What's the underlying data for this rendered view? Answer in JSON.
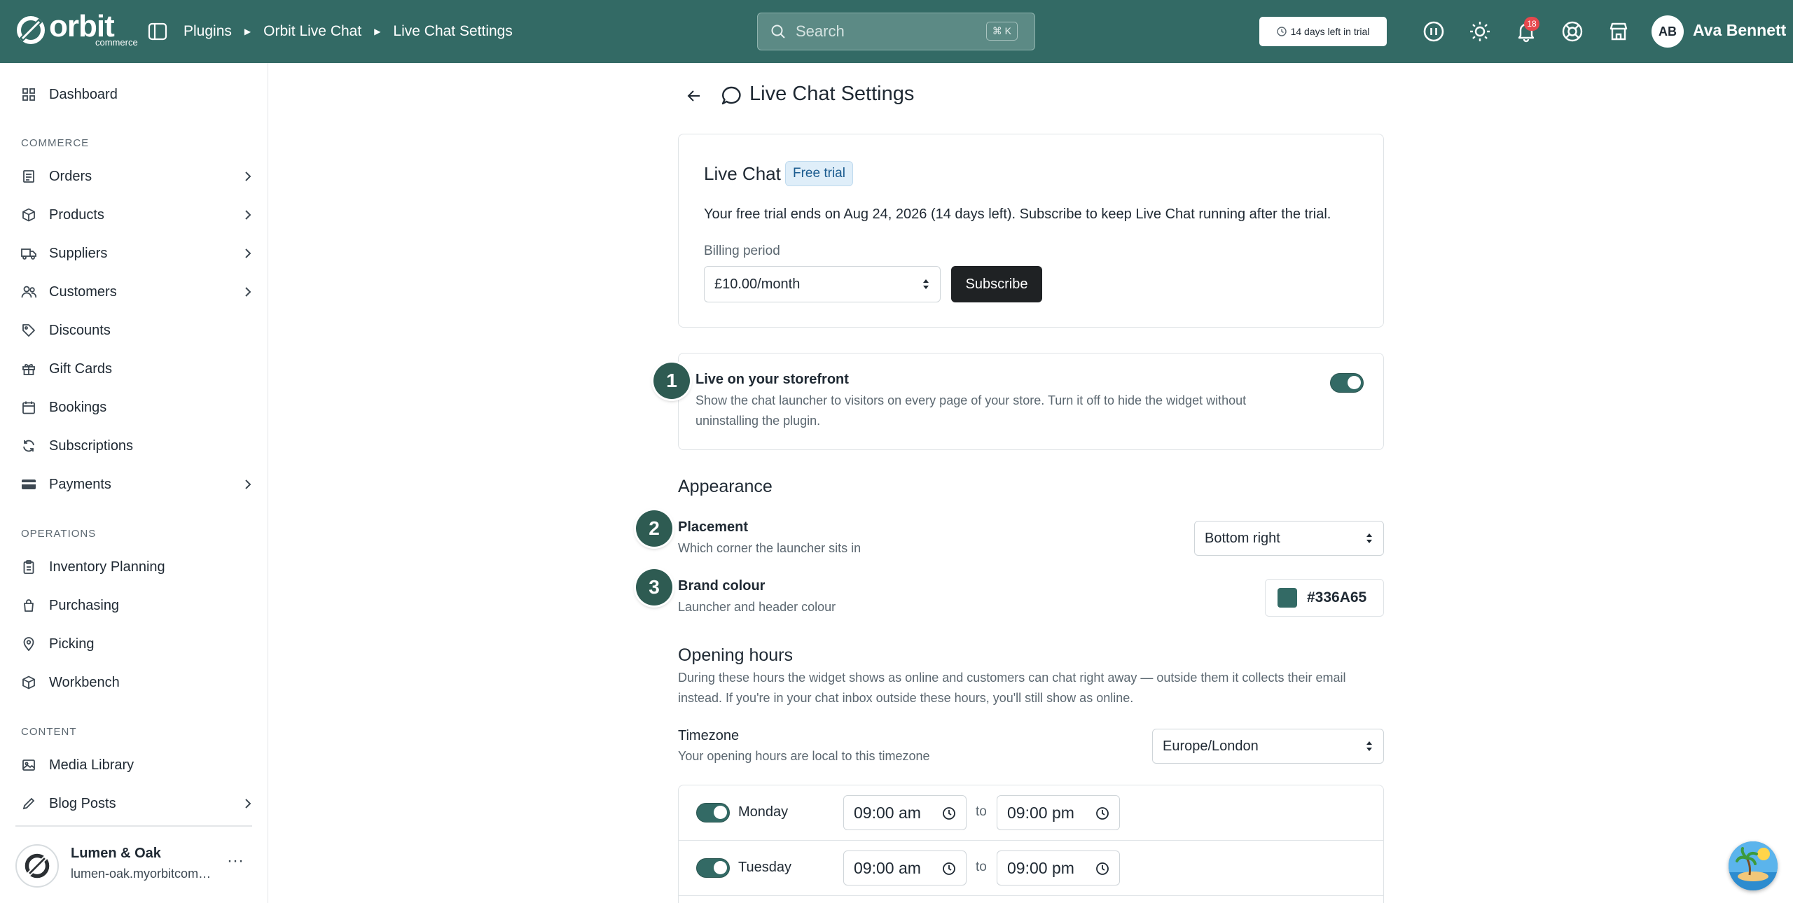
{
  "colors": {
    "brand": "#336A65",
    "danger": "#e5484d",
    "dark_button": "#1f2224"
  },
  "topbar": {
    "logo_text": "orbit",
    "logo_sub": "commerce",
    "breadcrumbs": [
      "Plugins",
      "Orbit Live Chat",
      "Live Chat Settings"
    ],
    "search_placeholder": "Search",
    "search_shortcut": "⌘ K",
    "trial_pill": "14 days left in trial",
    "notification_count": "18",
    "user_initials": "AB",
    "user_name": "Ava Bennett",
    "icons": [
      "sidebar-toggle-icon",
      "search-icon",
      "clock-icon",
      "pause-circle-icon",
      "sun-icon",
      "bell-icon",
      "help-lifebuoy-icon",
      "store-icon"
    ]
  },
  "sidebar": {
    "dashboard": "Dashboard",
    "sections": {
      "commerce": "COMMERCE",
      "operations": "OPERATIONS",
      "content": "CONTENT"
    },
    "commerce_items": [
      {
        "label": "Orders",
        "icon": "orders-icon",
        "expandable": true
      },
      {
        "label": "Products",
        "icon": "box-icon",
        "expandable": true
      },
      {
        "label": "Suppliers",
        "icon": "truck-icon",
        "expandable": true
      },
      {
        "label": "Customers",
        "icon": "users-icon",
        "expandable": true
      },
      {
        "label": "Discounts",
        "icon": "tag-icon",
        "expandable": false
      },
      {
        "label": "Gift Cards",
        "icon": "gift-icon",
        "expandable": false
      },
      {
        "label": "Bookings",
        "icon": "calendar-icon",
        "expandable": false
      },
      {
        "label": "Subscriptions",
        "icon": "refresh-icon",
        "expandable": false
      },
      {
        "label": "Payments",
        "icon": "card-icon",
        "expandable": true
      }
    ],
    "operations_items": [
      {
        "label": "Inventory Planning",
        "icon": "clipboard-icon"
      },
      {
        "label": "Purchasing",
        "icon": "cart-icon"
      },
      {
        "label": "Picking",
        "icon": "map-pin-icon"
      },
      {
        "label": "Workbench",
        "icon": "cube-icon"
      }
    ],
    "content_items": [
      {
        "label": "Media Library",
        "icon": "image-icon",
        "expandable": false
      },
      {
        "label": "Blog Posts",
        "icon": "pen-icon",
        "expandable": true
      }
    ],
    "store": {
      "name": "Lumen & Oak",
      "url": "lumen-oak.myorbitcommerce.com",
      "more": "···"
    }
  },
  "main": {
    "title": "Live Chat Settings",
    "plan_card": {
      "title": "Live Chat",
      "badge": "Free trial",
      "trial_text": "Your free trial ends on Aug 24, 2026 (14 days left). Subscribe to keep Live Chat running after the trial.",
      "billing_label": "Billing period",
      "billing_value": "£10.00/month",
      "subscribe": "Subscribe"
    },
    "storefront": {
      "step": "1",
      "title": "Live on your storefront",
      "desc": "Show the chat launcher to visitors on every page of your store. Turn it off to hide the widget without uninstalling the plugin.",
      "enabled": true
    },
    "appearance": {
      "heading": "Appearance",
      "placement": {
        "step": "2",
        "title": "Placement",
        "desc": "Which corner the launcher sits in",
        "value": "Bottom right"
      },
      "brand_colour": {
        "step": "3",
        "title": "Brand colour",
        "desc": "Launcher and header colour",
        "value": "#336A65"
      }
    },
    "opening_hours": {
      "heading": "Opening hours",
      "desc": "During these hours the widget shows as online and customers can chat right away — outside them it collects their email instead. If you're in your chat inbox outside these hours, you'll still show as online.",
      "timezone_title": "Timezone",
      "timezone_desc": "Your opening hours are local to this timezone",
      "timezone_value": "Europe/London",
      "to_label": "to",
      "days": [
        {
          "day": "Monday",
          "enabled": true,
          "from": "09:00 am",
          "to": "09:00 pm"
        },
        {
          "day": "Tuesday",
          "enabled": true,
          "from": "09:00 am",
          "to": "09:00 pm"
        }
      ]
    }
  }
}
